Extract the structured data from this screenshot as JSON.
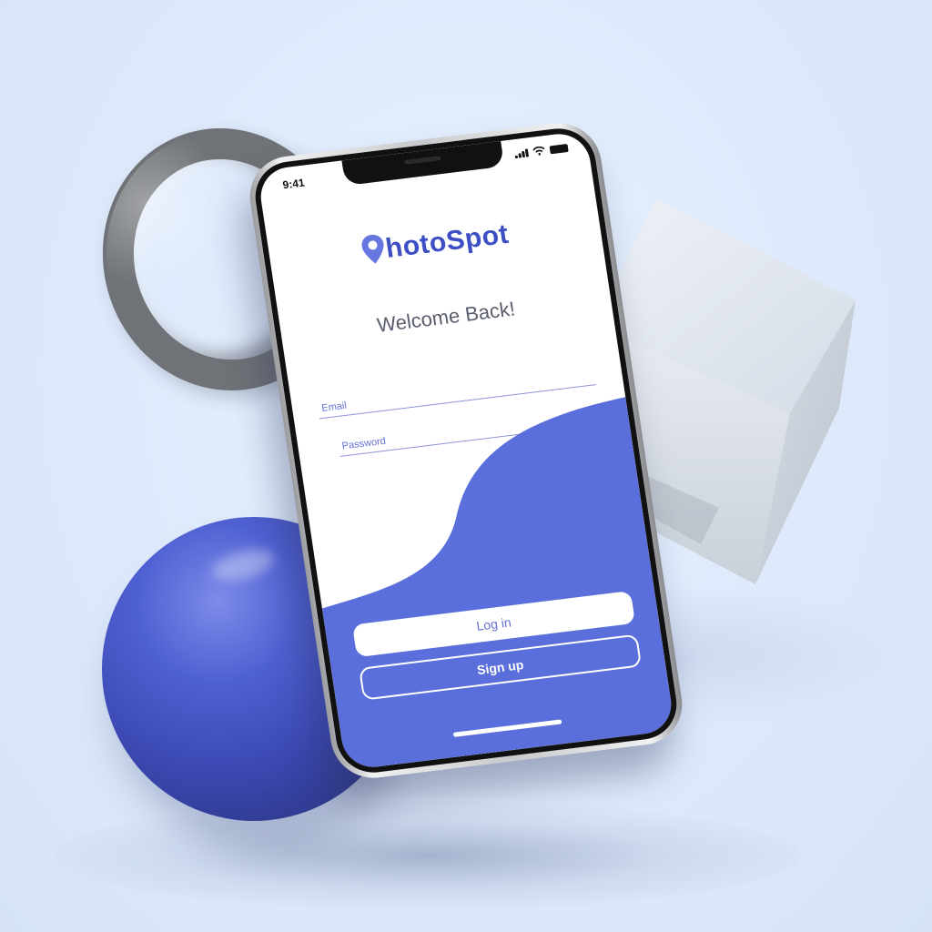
{
  "status_bar": {
    "time": "9:41"
  },
  "app": {
    "name": "PhotoSpot",
    "logo_rest": "hotoSpot"
  },
  "login": {
    "heading": "Welcome Back!",
    "email_placeholder": "Email",
    "password_placeholder": "Password",
    "login_label": "Log in",
    "signup_label": "Sign up"
  },
  "colors": {
    "brand": "#5a6edc",
    "brand_dark": "#3d4fc4",
    "background": "#e2edfc"
  },
  "icons": [
    "location-pin-icon",
    "signal-icon",
    "wifi-icon",
    "battery-icon"
  ]
}
